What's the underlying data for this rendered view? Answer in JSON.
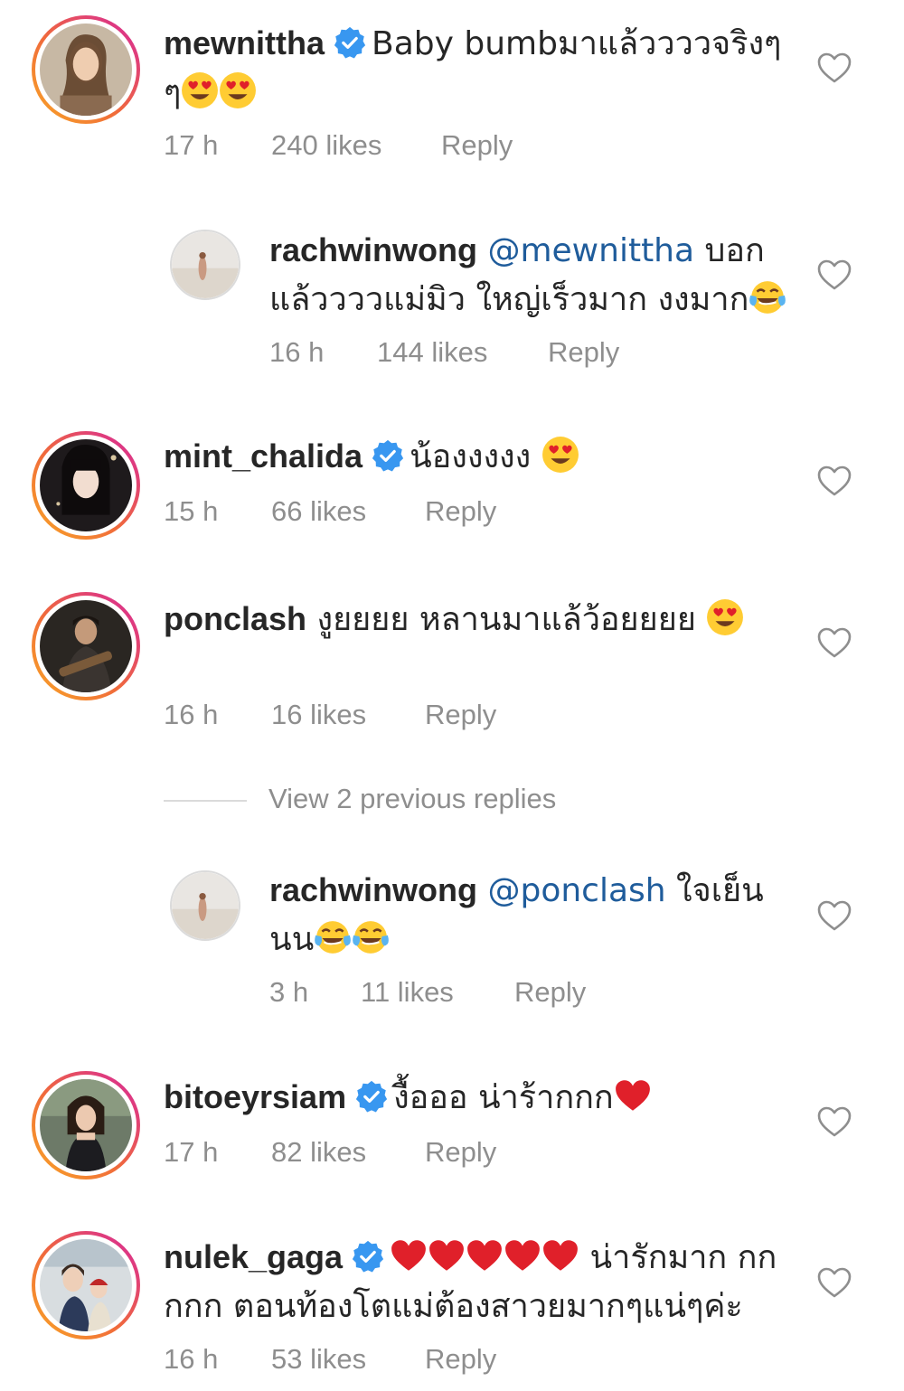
{
  "comments": [
    {
      "username": "mewnittha",
      "verified": true,
      "text_parts": [
        "Baby bumbมาแล้ววววจริงๆ ๆ"
      ],
      "emojis": [
        "heart-eyes",
        "heart-eyes"
      ],
      "time": "17 h",
      "likes": "240 likes",
      "reply": "Reply"
    },
    {
      "username": "rachwinwong",
      "mention": "@mewnittha",
      "text": "บอกแล้ววววแม่มิว ใหญ่เร็วมาก งงมาก",
      "emojis": [
        "tears-of-joy"
      ],
      "time": "16 h",
      "likes": "144 likes",
      "reply": "Reply"
    },
    {
      "username": "mint_chalida",
      "verified": true,
      "text": "น้องงงงง",
      "emojis": [
        "heart-eyes"
      ],
      "time": "15 h",
      "likes": "66 likes",
      "reply": "Reply"
    },
    {
      "username": "ponclash",
      "text": "งูยยยย หลานมาแล้ว้อยยยย",
      "emojis": [
        "heart-eyes"
      ],
      "time": "16 h",
      "likes": "16 likes",
      "reply": "Reply"
    },
    {
      "username": "rachwinwong",
      "mention": "@ponclash",
      "text": "ใจเย็น นน",
      "emojis": [
        "tears-of-joy",
        "tears-of-joy"
      ],
      "time": "3 h",
      "likes": "11 likes",
      "reply": "Reply"
    },
    {
      "username": "bitoeyrsiam",
      "verified": true,
      "text": "งื้อออ น่าร้ากกก",
      "emojis": [
        "red-heart"
      ],
      "time": "17 h",
      "likes": "82 likes",
      "reply": "Reply"
    },
    {
      "username": "nulek_gaga",
      "verified": true,
      "text": "น่ารักมาก กกกกก ตอนท้องโตแม่ต้องสาวยมากๆแน่ๆค่ะ",
      "emojis": [
        "red-heart",
        "red-heart",
        "red-heart",
        "red-heart",
        "red-heart"
      ],
      "time": "16 h",
      "likes": "53 likes",
      "reply": "Reply"
    }
  ],
  "view_previous_replies": "View 2 previous replies",
  "icons": {
    "like": "heart-outline-icon",
    "verified": "verified-badge-icon"
  },
  "colors": {
    "verified": "#3897f0",
    "meta": "#8e8e8e",
    "mention": "#1f5c9b",
    "heart": "#e0202a"
  }
}
